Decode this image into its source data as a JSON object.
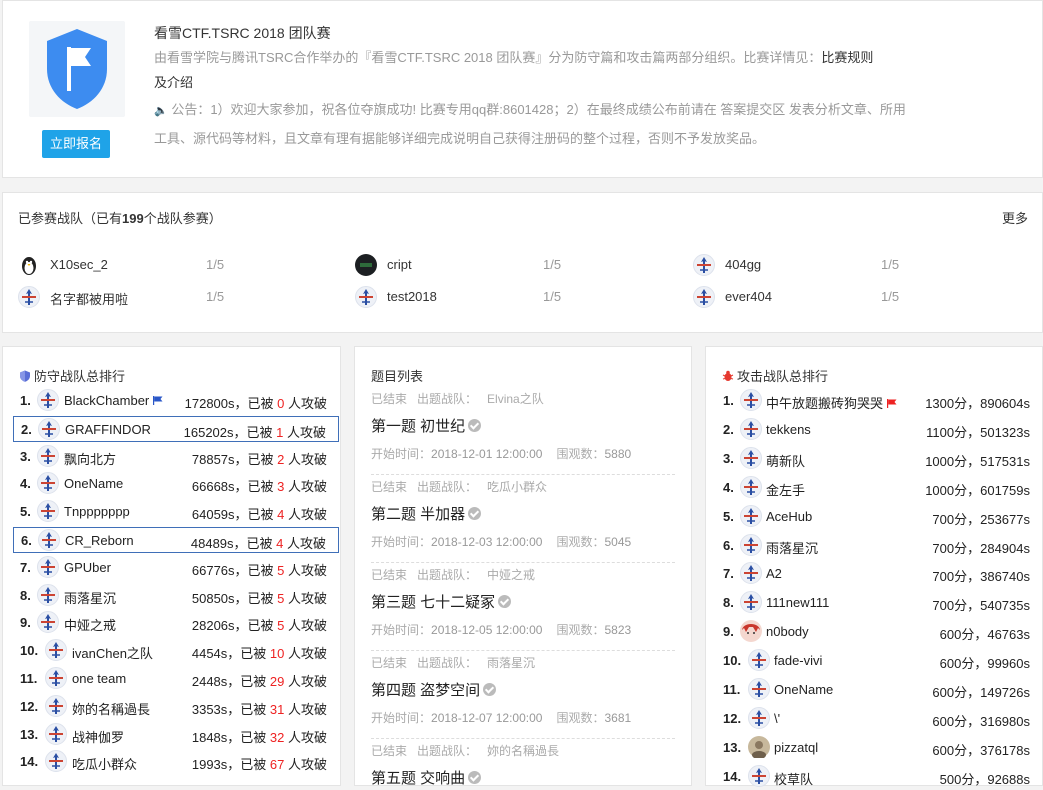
{
  "header": {
    "title": "看雪CTF.TSRC 2018 团队赛",
    "desc_prefix": "由看雪学院与腾讯TSRC合作举办的『看雪CTF.TSRC 2018 团队赛』分为防守篇和攻击篇两部分组织。比赛详情见：",
    "rules_link": "比赛规则",
    "desc_suffix": "及介绍",
    "notice": "公告：1）欢迎大家参加，祝各位夺旗成功! 比赛专用qq群:8601428；2）在最终成绩公布前请在 答案提交区 发表分析文章、所用工具、源代码等材料，且文章有理有据能够详细完成说明自己获得注册码的整个过程，否则不予发放奖品。",
    "signup_label": "立即报名",
    "accent": "#1fa3e8",
    "logo_color": "#3d8cf0",
    "icons": {
      "logo": "shield-flag-icon",
      "notice": "speaker-icon"
    }
  },
  "teams": {
    "heading_prefix": "已参赛战队（已有",
    "heading_count": "199",
    "heading_suffix": "个战队参赛）",
    "more_label": "更多",
    "items": [
      {
        "name": "X10sec_2",
        "ratio": "1/5",
        "avatar": "penguin-icon"
      },
      {
        "name": "cript",
        "ratio": "1/5",
        "avatar": "dark-circle-avatar"
      },
      {
        "name": "404gg",
        "ratio": "1/5",
        "avatar": "default-team-icon"
      },
      {
        "name": "名字都被用啦",
        "ratio": "1/5",
        "avatar": "default-team-icon"
      },
      {
        "name": "test2018",
        "ratio": "1/5",
        "avatar": "default-team-icon"
      },
      {
        "name": "ever404",
        "ratio": "1/5",
        "avatar": "default-team-icon"
      }
    ]
  },
  "defense": {
    "title": "防守战队总排行",
    "rows": [
      {
        "rank": "1.",
        "name": "BlackChamber",
        "time": "172800s，已被 ",
        "count": "0",
        "suffix": " 人攻破",
        "flag": true
      },
      {
        "rank": "2.",
        "name": "GRAFFINDOR",
        "time": "165202s，已被 ",
        "count": "1",
        "suffix": " 人攻破",
        "highlight": true
      },
      {
        "rank": "3.",
        "name": "飘向北方",
        "time": "78857s，已被 ",
        "count": "2",
        "suffix": " 人攻破"
      },
      {
        "rank": "4.",
        "name": "OneName",
        "time": "66668s，已被 ",
        "count": "3",
        "suffix": " 人攻破"
      },
      {
        "rank": "5.",
        "name": "Tnppppppp",
        "time": "64059s，已被 ",
        "count": "4",
        "suffix": " 人攻破"
      },
      {
        "rank": "6.",
        "name": "CR_Reborn",
        "time": "48489s，已被 ",
        "count": "4",
        "suffix": " 人攻破",
        "highlight": true
      },
      {
        "rank": "7.",
        "name": "GPUber",
        "time": "66776s，已被 ",
        "count": "5",
        "suffix": " 人攻破"
      },
      {
        "rank": "8.",
        "name": "雨落星沉",
        "time": "50850s，已被 ",
        "count": "5",
        "suffix": " 人攻破"
      },
      {
        "rank": "9.",
        "name": "中娅之戒",
        "time": "28206s，已被 ",
        "count": "5",
        "suffix": " 人攻破"
      },
      {
        "rank": "10.",
        "name": "ivanChen之队",
        "time": "4454s，已被 ",
        "count": "10",
        "suffix": " 人攻破"
      },
      {
        "rank": "11.",
        "name": "one team",
        "time": "2448s，已被 ",
        "count": "29",
        "suffix": " 人攻破"
      },
      {
        "rank": "12.",
        "name": "妳的名稱過長",
        "time": "3353s，已被 ",
        "count": "31",
        "suffix": " 人攻破"
      },
      {
        "rank": "13.",
        "name": "战神伽罗",
        "time": "1848s，已被 ",
        "count": "32",
        "suffix": " 人攻破"
      },
      {
        "rank": "14.",
        "name": "吃瓜小群众",
        "time": "1993s，已被 ",
        "count": "67",
        "suffix": " 人攻破"
      }
    ]
  },
  "problems": {
    "title": "题目列表",
    "status_label": "已结束",
    "team_label": "出题战队：",
    "start_label": "开始时间：",
    "views_label": "围观数：",
    "items": [
      {
        "team": "Elvina之队",
        "title": "第一题 初世纪",
        "start": "2018-12-01 12:00:00",
        "views": "5880"
      },
      {
        "team": "吃瓜小群众",
        "title": "第二题 半加器",
        "start": "2018-12-03 12:00:00",
        "views": "5045"
      },
      {
        "team": "中娅之戒",
        "title": "第三题 七十二疑冢",
        "start": "2018-12-05 12:00:00",
        "views": "5823"
      },
      {
        "team": "雨落星沉",
        "title": "第四题 盗梦空间",
        "start": "2018-12-07 12:00:00",
        "views": "3681"
      },
      {
        "team": "妳的名稱過長",
        "title": "第五题 交响曲",
        "start": "",
        "views": ""
      }
    ]
  },
  "attack": {
    "title": "攻击战队总排行",
    "rows": [
      {
        "rank": "1.",
        "name": "中午放题搬砖狗哭哭",
        "stat": "1300分，890604s",
        "flag": true
      },
      {
        "rank": "2.",
        "name": "tekkens",
        "stat": "1100分，501323s"
      },
      {
        "rank": "3.",
        "name": "萌新队",
        "stat": "1000分，517531s"
      },
      {
        "rank": "4.",
        "name": "金左手",
        "stat": "1000分，601759s"
      },
      {
        "rank": "5.",
        "name": "AceHub",
        "stat": "700分，253677s"
      },
      {
        "rank": "6.",
        "name": "雨落星沉",
        "stat": "700分，284904s"
      },
      {
        "rank": "7.",
        "name": "A2",
        "stat": "700分，386740s"
      },
      {
        "rank": "8.",
        "name": "111new111",
        "stat": "700分，540735s"
      },
      {
        "rank": "9.",
        "name": "n0body",
        "stat": "600分，46763s"
      },
      {
        "rank": "10.",
        "name": "fade-vivi",
        "stat": "600分，99960s"
      },
      {
        "rank": "11.",
        "name": "OneName",
        "stat": "600分，149726s"
      },
      {
        "rank": "12.",
        "name": "\\'",
        "stat": "600分，316980s"
      },
      {
        "rank": "13.",
        "name": "pizzatql",
        "stat": "600分，376178s"
      },
      {
        "rank": "14.",
        "name": "校草队",
        "stat": "500分，92688s"
      }
    ]
  }
}
